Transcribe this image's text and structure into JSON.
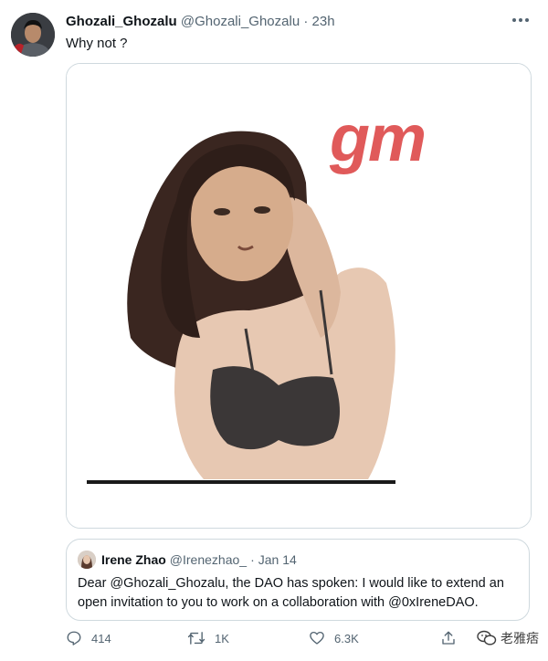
{
  "tweet": {
    "author_name": "Ghozali_Ghozalu",
    "author_handle": "@Ghozali_Ghozalu",
    "separator": "·",
    "time": "23h",
    "text": "Why not ?"
  },
  "media": {
    "overlay_text": "gm"
  },
  "quote": {
    "author_name": "Irene Zhao",
    "author_handle": "@Irenezhao_",
    "separator": "·",
    "date": "Jan 14",
    "body": "Dear @Ghozali_Ghozalu, the DAO has spoken: I would like to extend an open invitation to you to work on a collaboration with @0xIreneDAO."
  },
  "actions": {
    "reply_count": "414",
    "retweet_count": "1K",
    "like_count": "6.3K"
  },
  "watermark": {
    "text": "老雅痞"
  },
  "colors": {
    "gm_text": "#e05a5a",
    "secondary_text": "#536471",
    "border": "#cfd9de"
  },
  "icons": [
    "more-icon",
    "reply-icon",
    "retweet-icon",
    "like-icon",
    "share-icon",
    "wechat-icon"
  ]
}
